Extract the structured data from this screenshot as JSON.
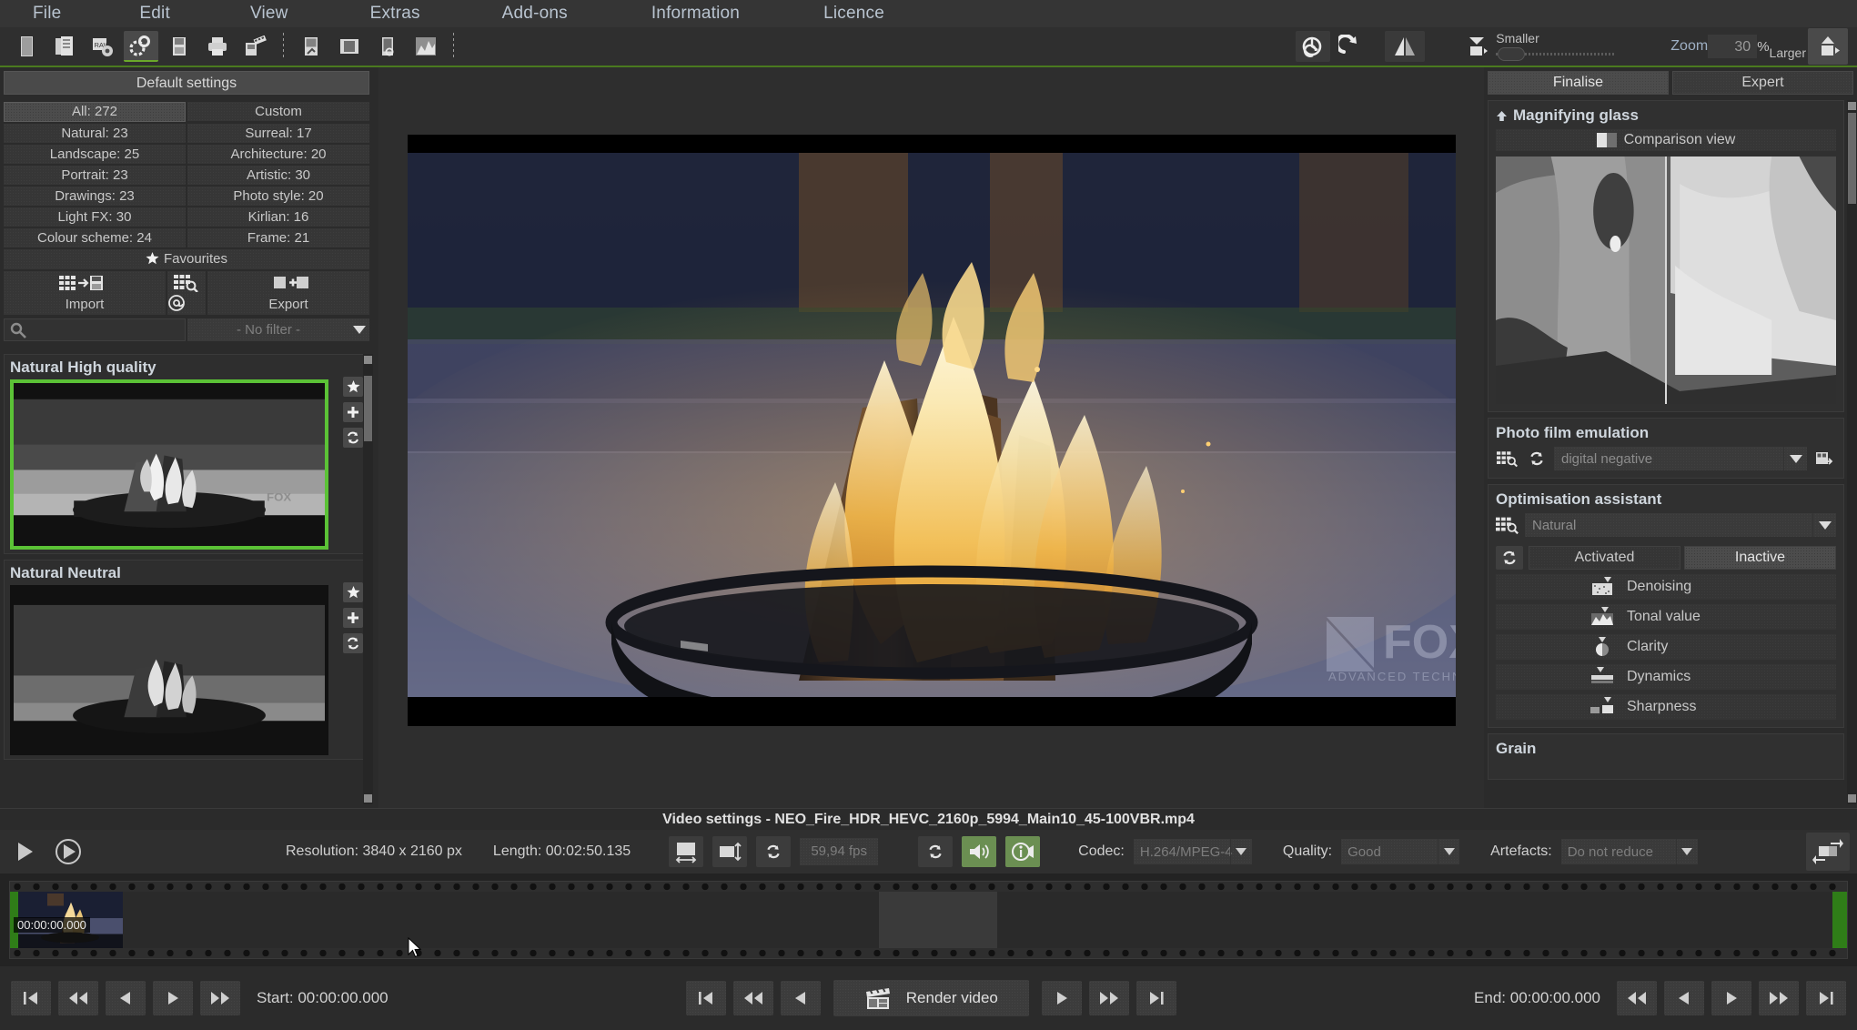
{
  "menu": {
    "items": [
      {
        "label": "File"
      },
      {
        "label": "Edit"
      },
      {
        "label": "View"
      },
      {
        "label": "Extras"
      },
      {
        "label": "Add-ons"
      },
      {
        "label": "Information"
      },
      {
        "label": "Licence"
      }
    ]
  },
  "toolbar": {
    "icons": [
      {
        "name": "new-document-icon"
      },
      {
        "name": "open-documents-icon"
      },
      {
        "name": "raw-import-icon"
      },
      {
        "name": "settings-gears-icon"
      },
      {
        "name": "save-icon"
      },
      {
        "name": "print-icon"
      },
      {
        "name": "batch-film-icon"
      },
      {
        "name": "edit-image-icon"
      },
      {
        "name": "compare-images-icon"
      },
      {
        "name": "inspect-image-icon"
      },
      {
        "name": "histogram-icon"
      }
    ],
    "right_icons": [
      {
        "name": "rotate-reset-icon"
      },
      {
        "name": "redo-icon"
      },
      {
        "name": "mirror-icon"
      },
      {
        "name": "video-smaller-icon"
      }
    ],
    "smaller_label": "Smaller",
    "larger_label": "Larger",
    "zoom_label": "Zoom",
    "zoom_value": "30",
    "percent": "%"
  },
  "left_panel": {
    "default_settings": "Default settings",
    "categories": [
      {
        "label": "All: 272",
        "selected": true
      },
      {
        "label": "Custom",
        "selected": false
      },
      {
        "label": "Natural: 23",
        "selected": false
      },
      {
        "label": "Surreal: 17",
        "selected": false
      },
      {
        "label": "Landscape: 25",
        "selected": false
      },
      {
        "label": "Architecture: 20",
        "selected": false
      },
      {
        "label": "Portrait: 23",
        "selected": false
      },
      {
        "label": "Artistic: 30",
        "selected": false
      },
      {
        "label": "Drawings: 23",
        "selected": false
      },
      {
        "label": "Photo style: 20",
        "selected": false
      },
      {
        "label": "Light FX: 30",
        "selected": false
      },
      {
        "label": "Kirlian: 16",
        "selected": false
      },
      {
        "label": "Colour scheme: 24",
        "selected": false
      },
      {
        "label": "Frame: 21",
        "selected": false
      }
    ],
    "favourites": "Favourites",
    "import_label": "Import",
    "export_label": "Export",
    "search_placeholder": "",
    "filter_value": "- No filter -",
    "presets": [
      {
        "title": "Natural High quality",
        "selected": true
      },
      {
        "title": "Natural Neutral",
        "selected": false
      }
    ]
  },
  "preview": {
    "watermark_main": "FOX",
    "watermark_sub": "ADVANCED TECHNOLOGY LAB"
  },
  "right_panel": {
    "tabs": [
      {
        "label": "Finalise",
        "active": true
      },
      {
        "label": "Expert",
        "active": false
      }
    ],
    "magnifying_glass": {
      "title": "Magnifying glass",
      "comparison_view": "Comparison view"
    },
    "photo_film": {
      "title": "Photo film emulation",
      "value": "digital negative"
    },
    "optimisation": {
      "title": "Optimisation assistant",
      "preset": "Natural",
      "activated_label": "Activated",
      "inactive_label": "Inactive",
      "inactive_selected": true,
      "effects": [
        {
          "label": "Denoising",
          "icon": "denoise-icon"
        },
        {
          "label": "Tonal value",
          "icon": "tonal-value-icon"
        },
        {
          "label": "Clarity",
          "icon": "clarity-icon"
        },
        {
          "label": "Dynamics",
          "icon": "dynamics-icon"
        },
        {
          "label": "Sharpness",
          "icon": "sharpness-icon"
        }
      ]
    },
    "grain": {
      "title": "Grain"
    }
  },
  "video_settings": {
    "title": "Video settings - NEO_Fire_HDR_HEVC_2160p_5994_Main10_45-100VBR.mp4",
    "resolution": "Resolution: 3840 x 2160 px",
    "length": "Length: 00:02:50.135",
    "fps": "59,94 fps",
    "codec_label": "Codec:",
    "codec_value": "H.264/MPEG-4",
    "quality_label": "Quality:",
    "quality_value": "Good",
    "artefacts_label": "Artefacts:",
    "artefacts_value": "Do not reduce"
  },
  "timeline": {
    "clip_time": "00:00:00.000"
  },
  "transport": {
    "start_label": "Start: 00:00:00.000",
    "end_label": "End: 00:00:00.000",
    "render_label": "Render video"
  },
  "colors": {
    "accent_green": "#5bc236",
    "toolbar_rule": "#4a7a1f",
    "panel_bg": "#2b2b2b",
    "selected_tab": "#4c4c4c"
  }
}
